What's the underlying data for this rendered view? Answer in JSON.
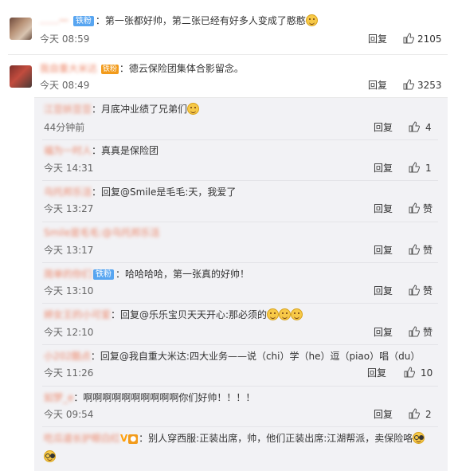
{
  "comments": [
    {
      "username": "……一",
      "badge": "铁粉",
      "text": "：第一张都好帅，第二张已经有好多人变成了憨憨",
      "time": "今天 08:59",
      "reply_label": "回复",
      "likes": "2105"
    },
    {
      "username": "我自重大米达",
      "badge": "铁粉",
      "text": "：德云保险团集体合影留念。",
      "time": "今天 08:49",
      "reply_label": "回复",
      "likes": "3253"
    }
  ],
  "replies": [
    {
      "username": "江豆妖豆豆",
      "badge": "",
      "text": "：月底冲业绩了兄弟们",
      "emoji": "smile",
      "time": "44分钟前",
      "reply_label": "回复",
      "likes": "4"
    },
    {
      "username": "福为一时人",
      "badge": "",
      "text": "：真真是保险团",
      "emoji": "",
      "time": "今天 14:31",
      "reply_label": "回复",
      "likes": "1"
    },
    {
      "username": "乌托邦乐活",
      "badge": "",
      "text": "：回复@Smile是毛毛:天，我爱了",
      "emoji": "",
      "time": "今天 13:27",
      "reply_label": "回复",
      "likes": "赞"
    },
    {
      "username": "Smile是毛毛:@乌托邦乐活",
      "badge": "",
      "text": "",
      "emoji": "",
      "time": "今天 13:17",
      "reply_label": "回复",
      "likes": "赞"
    },
    {
      "username": "简单的你们",
      "badge": "铁粉",
      "text": "：哈哈哈哈，第一张真的好帅！",
      "emoji": "",
      "time": "今天 13:10",
      "reply_label": "回复",
      "likes": "赞"
    },
    {
      "username": "婷女王的小可爱",
      "badge": "",
      "text": "：回复@乐乐宝贝天天开心:那必须的",
      "emoji": "triple",
      "time": "今天 12:10",
      "reply_label": "回复",
      "likes": "赞"
    },
    {
      "username": "小202酷点",
      "badge": "",
      "text": "：回复@我自重大米达:四大业务——说（chi）学（he）逗（piao）唱（du）",
      "emoji": "",
      "time": "今天 11:26",
      "reply_label": "回复",
      "likes": "10"
    },
    {
      "username": "如梦_e",
      "badge": "",
      "text": "：啊啊啊啊啊啊啊啊啊啊你们好帅！！！！",
      "emoji": "",
      "time": "今天 09:54",
      "reply_label": "回复",
      "likes": "2"
    },
    {
      "username": "吃瓜道长护眼白红",
      "badge": "V",
      "text": "：别人穿西服:正装出席，帅，他们正装出席:江湖帮派，卖保险咯",
      "emoji": "glasses",
      "time": "",
      "reply_label": "",
      "likes": ""
    }
  ],
  "icons": {
    "like": "thumb-up-icon"
  },
  "colors": {
    "username": "#eb7350",
    "badge": "#57a5f1",
    "reply_bg": "#f2f2f5"
  }
}
